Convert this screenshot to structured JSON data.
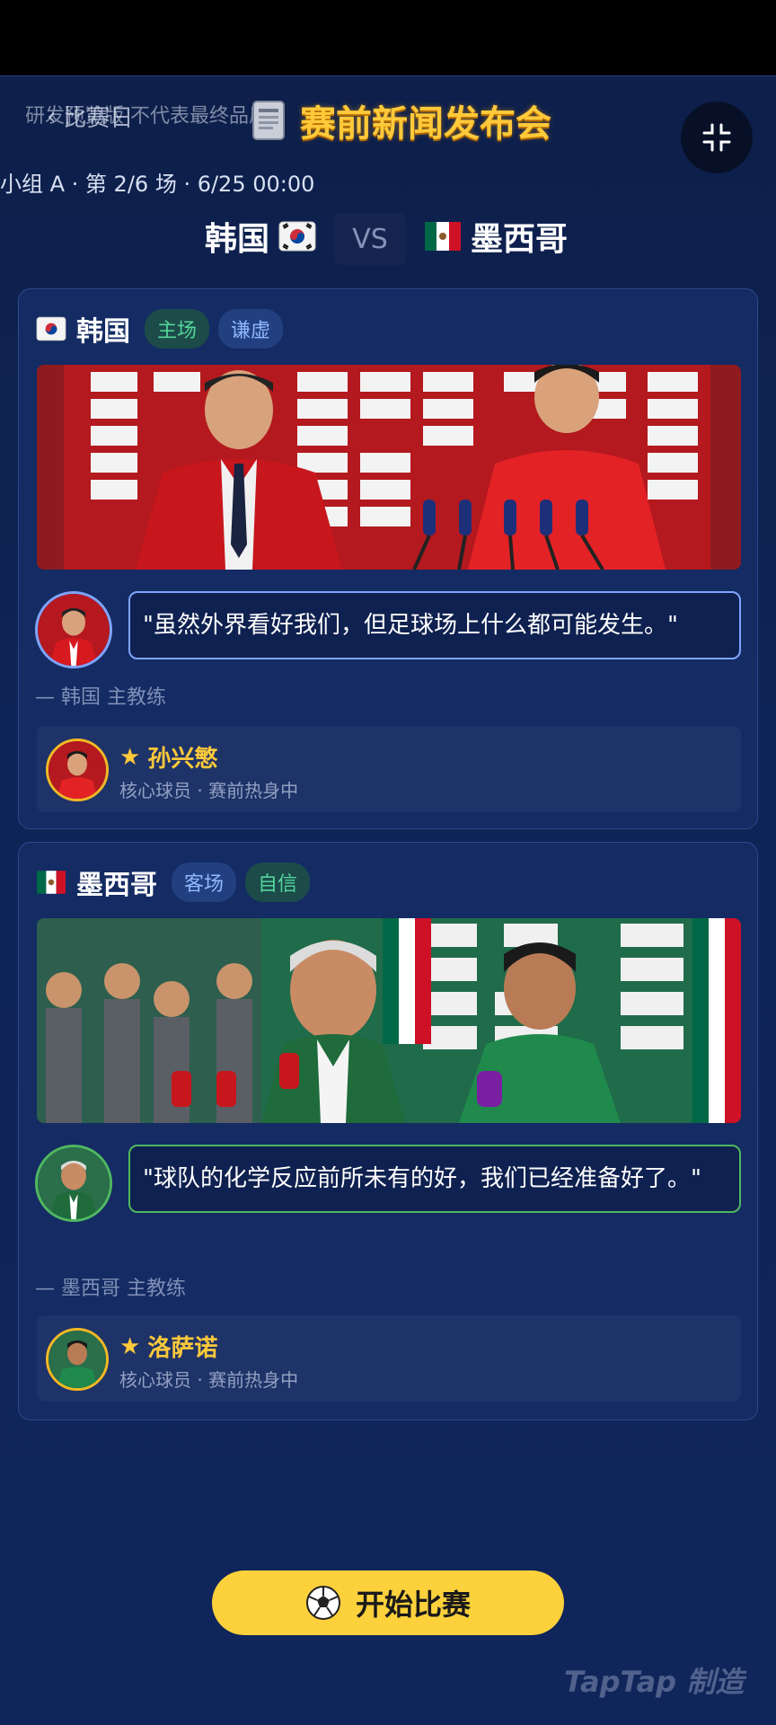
{
  "header": {
    "watermark": "研发预览版  不代表最终品质",
    "back_label": "比赛日",
    "title": "赛前新闻发布会",
    "meta": "小组 A · 第 2/6 场 · 6/25 00:00",
    "vs_label": "VS",
    "home_team": "韩国",
    "away_team": "墨西哥"
  },
  "cards": [
    {
      "team": "韩国",
      "tags": [
        "主场",
        "谦虚"
      ],
      "quote": "\"虽然外界看好我们，但足球场上什么都可能发生。\"",
      "caption": "— 韩国 主教练",
      "player_name": "孙兴慜",
      "player_status": "核心球员 · 赛前热身中",
      "accent": "#7fa4ff"
    },
    {
      "team": "墨西哥",
      "tags": [
        "客场",
        "自信"
      ],
      "quote": "\"球队的化学反应前所未有的好，我们已经准备好了。\"",
      "caption": "— 墨西哥 主教练",
      "player_name": "洛萨诺",
      "player_status": "核心球员 · 赛前热身中",
      "accent": "#4fb860"
    }
  ],
  "cta": {
    "label": "开始比赛",
    "icon": "soccer-ball-icon"
  },
  "branding": {
    "text": "TapTap 制造"
  },
  "colors": {
    "accent_yellow": "#ffc93a",
    "button_yellow": "#fdd13c",
    "bg": "#0f2456"
  },
  "icons": [
    "chevron-left-icon",
    "document-icon",
    "collapse-icon",
    "korea-flag-icon",
    "mexico-flag-icon",
    "star-icon"
  ]
}
